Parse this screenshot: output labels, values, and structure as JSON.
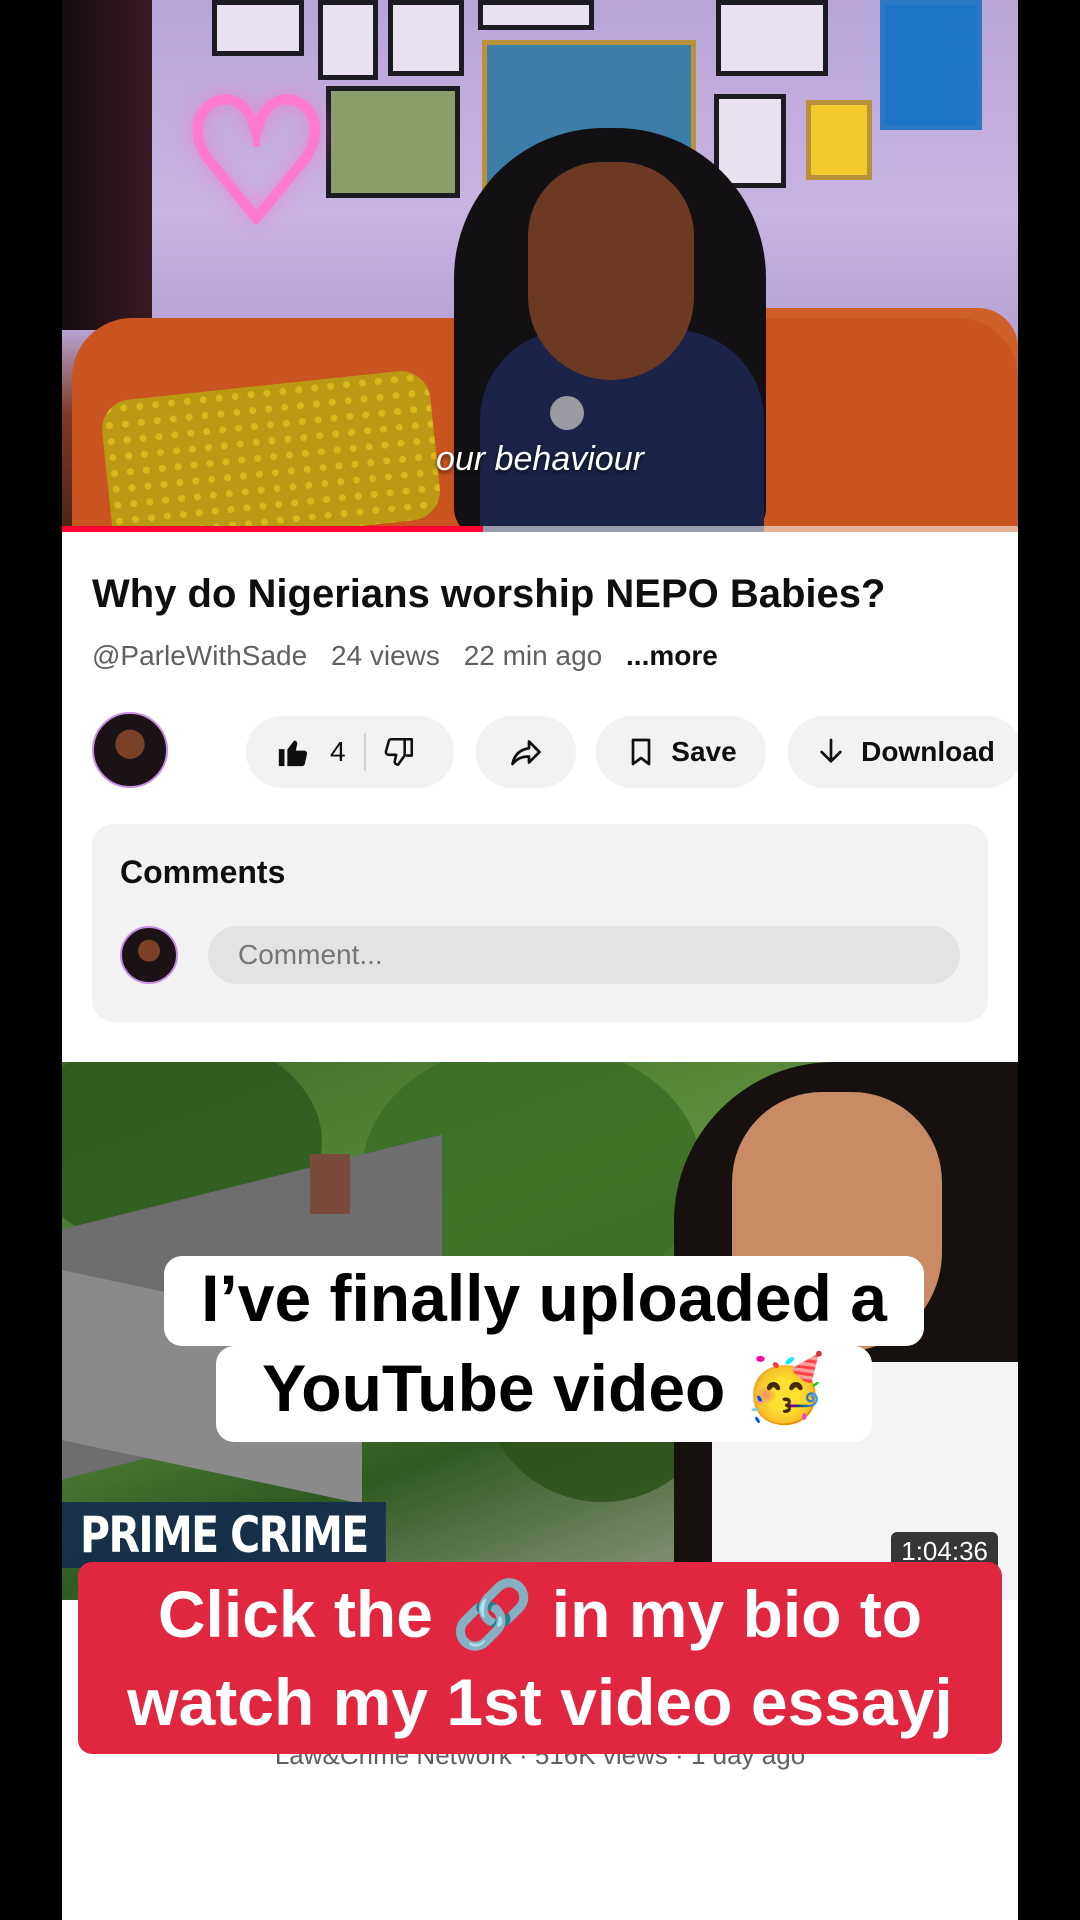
{
  "player": {
    "caption": "our behaviour",
    "progress_fraction": 0.44
  },
  "video": {
    "title": "Why do Nigerians worship NEPO Babies?",
    "channel": "@ParleWithSade",
    "views": "24 views",
    "age": "22 min ago",
    "more": "...more"
  },
  "actions": {
    "like_count": "4",
    "save_label": "Save",
    "download_label": "Download",
    "icons": [
      "thumbs-up-icon",
      "thumbs-down-icon",
      "share-icon",
      "bookmark-icon",
      "download-icon"
    ]
  },
  "comments": {
    "title": "Comments",
    "placeholder": "Comment..."
  },
  "next_video": {
    "brand_badge": "PRIME CRIME",
    "duration": "1:04:36",
    "meta": "Law&Crime Network · 516K views · 1 day ago"
  },
  "overlay": {
    "line1": "I’ve finally uploaded a",
    "line2": "YouTube video 🥳",
    "banner_line1": "Click the 🔗 in my bio to",
    "banner_line2": "watch my 1st video essayj"
  },
  "colors": {
    "accent": "#ff0033",
    "banner": "#e0273f",
    "text": "#0f0f0f",
    "secondary_text": "#606060",
    "pill_bg": "#f2f2f2"
  }
}
